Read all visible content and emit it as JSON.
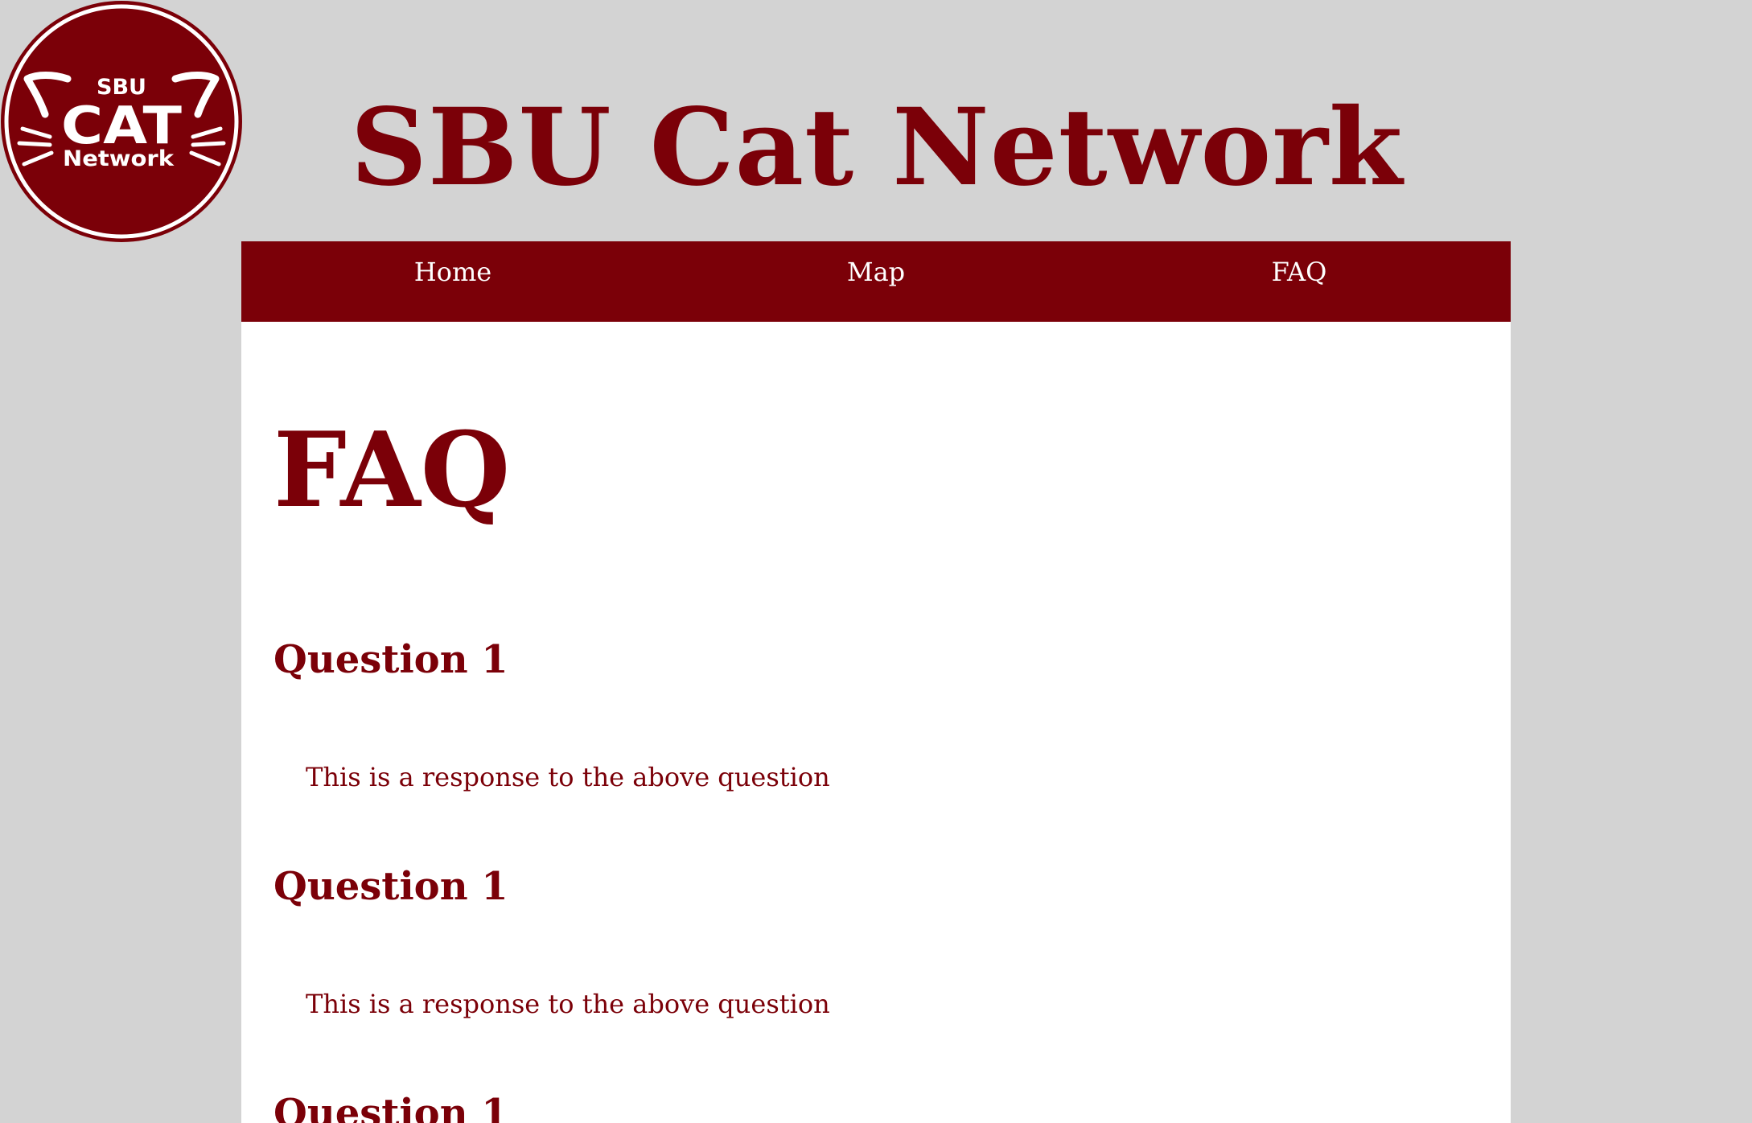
{
  "logo": {
    "line1": "SBU",
    "line2": "CAT",
    "line3": "Network",
    "color": "#7b0008"
  },
  "site_title": "SBU Cat Network",
  "nav": {
    "items": [
      {
        "label": "Home"
      },
      {
        "label": "Map"
      },
      {
        "label": "FAQ"
      }
    ]
  },
  "page": {
    "heading": "FAQ",
    "faqs": [
      {
        "question": "Question 1",
        "answer": "This is a response to the above question"
      },
      {
        "question": "Question 1",
        "answer": "This is a response to the above question"
      },
      {
        "question": "Question 1",
        "answer": ""
      }
    ]
  },
  "colors": {
    "brand": "#7b0008",
    "background": "#d3d3d3",
    "content_background": "#ffffff"
  }
}
